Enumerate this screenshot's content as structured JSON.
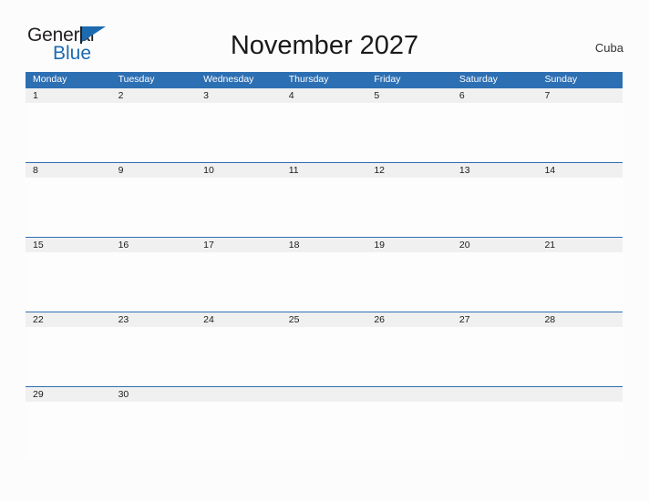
{
  "brand": {
    "name_part1": "General",
    "name_part2": "Blue",
    "flag_icon": "triangle-flag-icon",
    "colors": {
      "text": "#231f20",
      "blue": "#1c6bb0"
    }
  },
  "header": {
    "title": "November 2027",
    "region": "Cuba"
  },
  "calendar": {
    "colors": {
      "header_blue": "#2d6fb3",
      "date_strip_gray": "#f0f0f0",
      "page_background": "#fcfcfc"
    },
    "weekdays": [
      "Monday",
      "Tuesday",
      "Wednesday",
      "Thursday",
      "Friday",
      "Saturday",
      "Sunday"
    ],
    "weeks": [
      {
        "dates": [
          "1",
          "2",
          "3",
          "4",
          "5",
          "6",
          "7"
        ],
        "events": [
          "",
          "",
          "",
          "",
          "",
          "",
          ""
        ]
      },
      {
        "dates": [
          "8",
          "9",
          "10",
          "11",
          "12",
          "13",
          "14"
        ],
        "events": [
          "",
          "",
          "",
          "",
          "",
          "",
          ""
        ]
      },
      {
        "dates": [
          "15",
          "16",
          "17",
          "18",
          "19",
          "20",
          "21"
        ],
        "events": [
          "",
          "",
          "",
          "",
          "",
          "",
          ""
        ]
      },
      {
        "dates": [
          "22",
          "23",
          "24",
          "25",
          "26",
          "27",
          "28"
        ],
        "events": [
          "",
          "",
          "",
          "",
          "",
          "",
          ""
        ]
      },
      {
        "dates": [
          "29",
          "30",
          "",
          "",
          "",
          "",
          ""
        ],
        "events": [
          "",
          "",
          "",
          "",
          "",
          "",
          ""
        ]
      }
    ]
  }
}
